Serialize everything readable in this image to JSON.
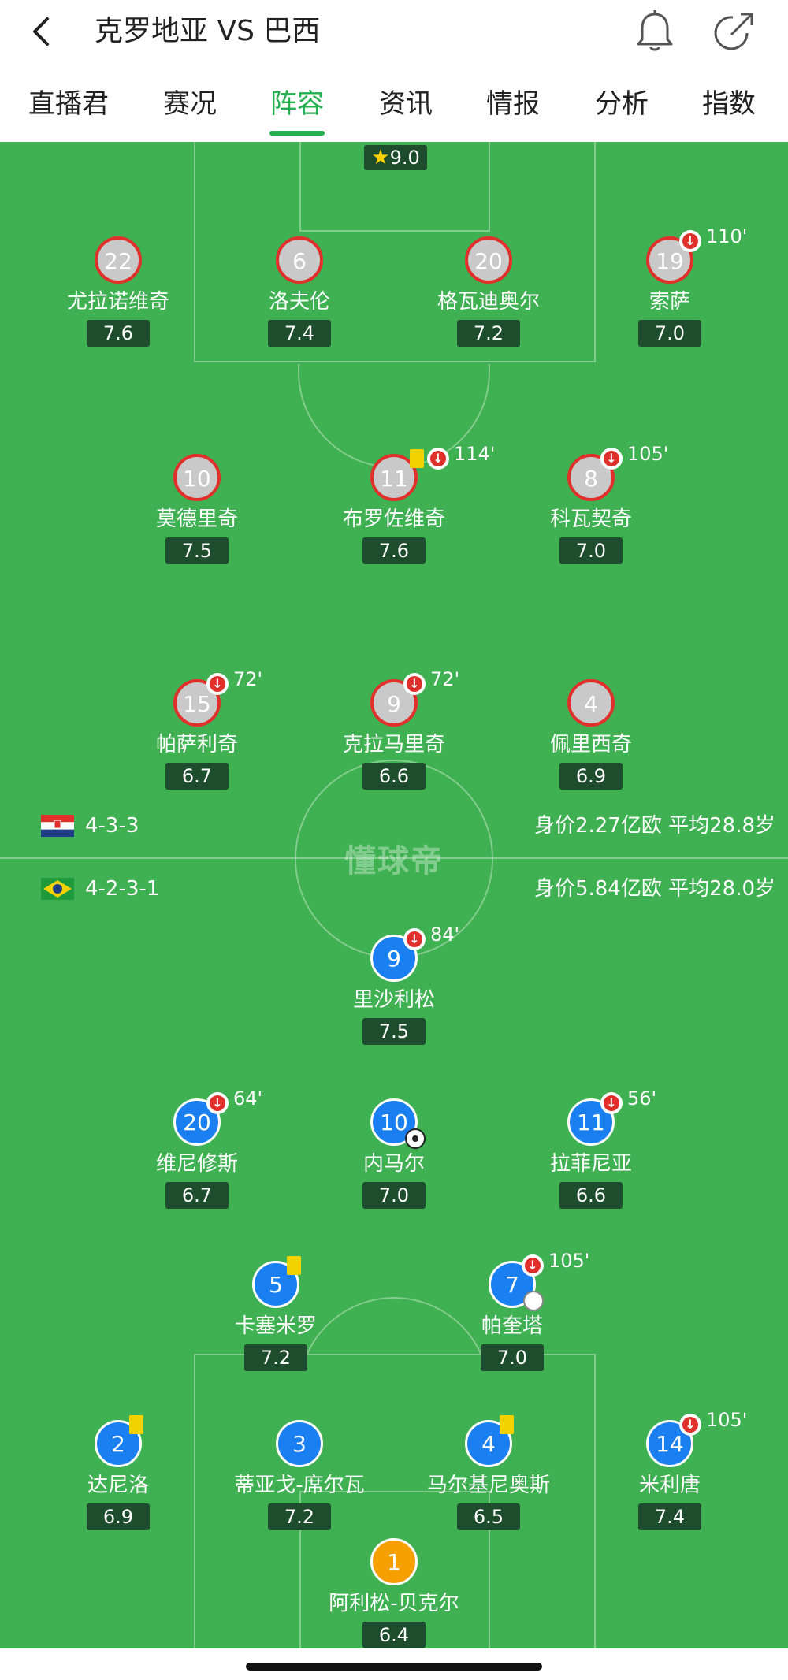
{
  "header": {
    "title": "克罗地亚 VS 巴西",
    "icons": [
      "back-icon",
      "bell-icon",
      "share-icon"
    ]
  },
  "tabs": [
    {
      "label": "直播君"
    },
    {
      "label": "赛况"
    },
    {
      "label": "阵容",
      "active": true
    },
    {
      "label": "资讯"
    },
    {
      "label": "情报"
    },
    {
      "label": "分析"
    },
    {
      "label": "指数"
    }
  ],
  "top_rating": "9.0",
  "watermark": "懂球帝",
  "croatia": {
    "formation": "4-3-3",
    "info": "身价2.27亿欧  平均28.8岁",
    "players": [
      {
        "number": "22",
        "name": "尤拉诺维奇",
        "rating": "7.6"
      },
      {
        "number": "6",
        "name": "洛夫伦",
        "rating": "7.4"
      },
      {
        "number": "20",
        "name": "格瓦迪奥尔",
        "rating": "7.2"
      },
      {
        "number": "19",
        "name": "索萨",
        "rating": "7.0",
        "sub_time": "110'"
      },
      {
        "number": "10",
        "name": "莫德里奇",
        "rating": "7.5"
      },
      {
        "number": "11",
        "name": "布罗佐维奇",
        "rating": "7.6",
        "sub_time": "114'",
        "yellow": true
      },
      {
        "number": "8",
        "name": "科瓦契奇",
        "rating": "7.0",
        "sub_time": "105'"
      },
      {
        "number": "15",
        "name": "帕萨利奇",
        "rating": "6.7",
        "sub_time": "72'"
      },
      {
        "number": "9",
        "name": "克拉马里奇",
        "rating": "6.6",
        "sub_time": "72'"
      },
      {
        "number": "4",
        "name": "佩里西奇",
        "rating": "6.9"
      }
    ]
  },
  "brazil": {
    "formation": "4-2-3-1",
    "info": "身价5.84亿欧  平均28.0岁",
    "players": [
      {
        "number": "9",
        "name": "里沙利松",
        "rating": "7.5",
        "sub_time": "84'"
      },
      {
        "number": "20",
        "name": "维尼修斯",
        "rating": "6.7",
        "sub_time": "64'"
      },
      {
        "number": "10",
        "name": "内马尔",
        "rating": "7.0",
        "goal": true
      },
      {
        "number": "11",
        "name": "拉菲尼亚",
        "rating": "6.6",
        "sub_time": "56'"
      },
      {
        "number": "5",
        "name": "卡塞米罗",
        "rating": "7.2",
        "yellow": true
      },
      {
        "number": "7",
        "name": "帕奎塔",
        "rating": "7.0",
        "sub_time": "105'",
        "assist": true
      },
      {
        "number": "2",
        "name": "达尼洛",
        "rating": "6.9",
        "yellow": true
      },
      {
        "number": "3",
        "name": "蒂亚戈-席尔瓦",
        "rating": "7.2"
      },
      {
        "number": "4",
        "name": "马尔基尼奥斯",
        "rating": "6.5",
        "yellow": true
      },
      {
        "number": "14",
        "name": "米利唐",
        "rating": "7.4",
        "sub_time": "105'"
      },
      {
        "number": "1",
        "name": "阿利松-贝克尔",
        "rating": "6.4"
      }
    ]
  },
  "colors": {
    "accent": "#23b04e",
    "pitch": "#3fb152",
    "croatia_border": "#e0302b",
    "brazil_fill": "#1a7ff0",
    "gk_fill": "#f5a000",
    "yellow_card": "#f2d200"
  }
}
